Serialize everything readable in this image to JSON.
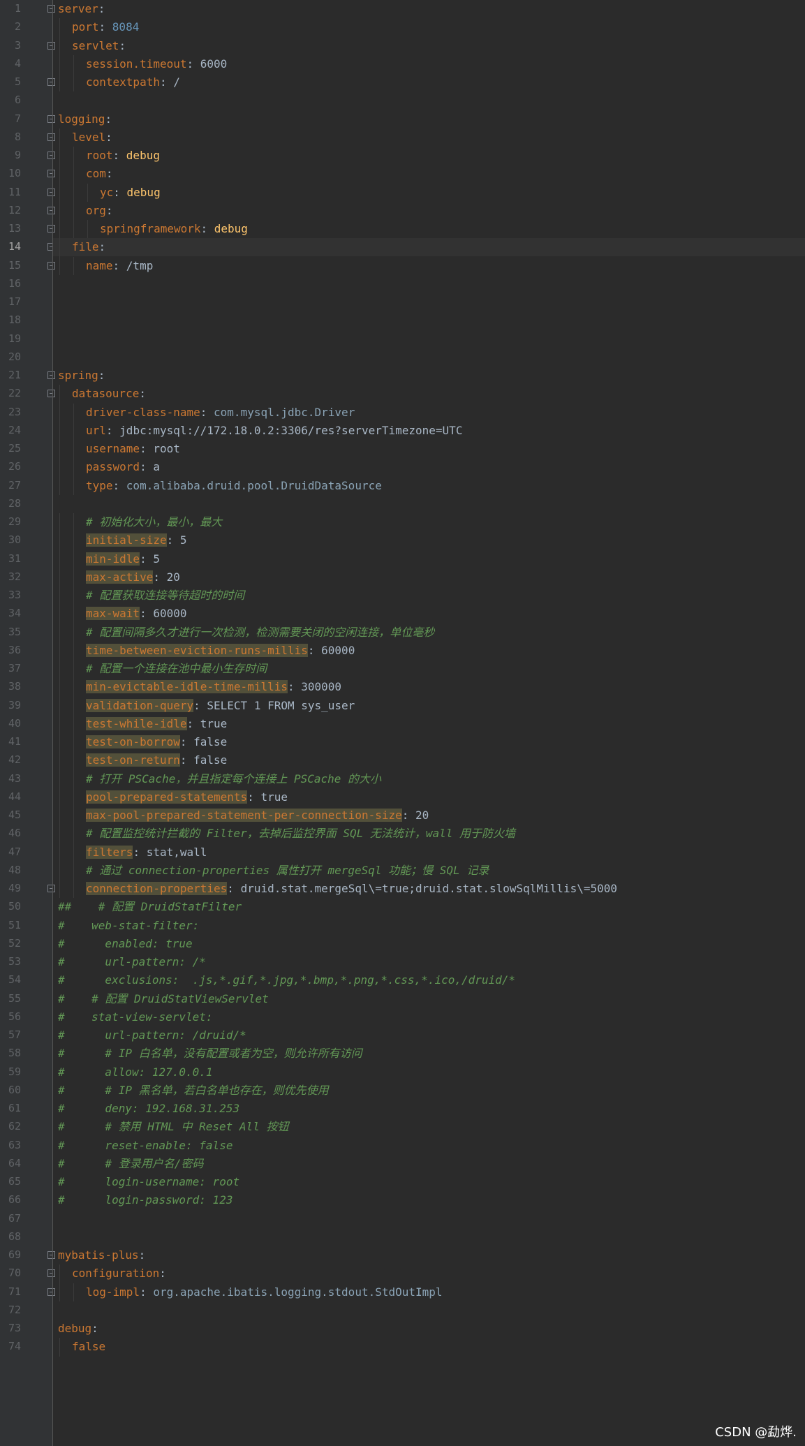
{
  "editor": {
    "current_line": 14,
    "lines": [
      {
        "n": "1",
        "indent": 0,
        "key": "server",
        "sep": ":",
        "val": "",
        "vtype": "",
        "fold": true
      },
      {
        "n": "2",
        "indent": 1,
        "key": "port",
        "sep": ": ",
        "val": "8084",
        "vtype": "vn"
      },
      {
        "n": "3",
        "indent": 1,
        "key": "servlet",
        "sep": ":",
        "val": "",
        "vtype": "",
        "fold": true
      },
      {
        "n": "4",
        "indent": 2,
        "key": "session.timeout",
        "sep": ": ",
        "val": "6000",
        "vtype": "v"
      },
      {
        "n": "5",
        "indent": 2,
        "key": "contextpath",
        "sep": ": ",
        "val": "/",
        "vtype": "v",
        "fold": true
      },
      {
        "n": "6",
        "indent": 0,
        "key": "",
        "sep": "",
        "val": "",
        "vtype": ""
      },
      {
        "n": "7",
        "indent": 0,
        "key": "logging",
        "sep": ":",
        "val": "",
        "vtype": "",
        "fold": true
      },
      {
        "n": "8",
        "indent": 1,
        "key": "level",
        "sep": ":",
        "val": "",
        "vtype": "",
        "fold": true
      },
      {
        "n": "9",
        "indent": 2,
        "key": "root",
        "sep": ": ",
        "val": "debug",
        "vtype": "vk",
        "fold": true
      },
      {
        "n": "10",
        "indent": 2,
        "key": "com",
        "sep": ":",
        "val": "",
        "vtype": "",
        "fold": true
      },
      {
        "n": "11",
        "indent": 3,
        "key": "yc",
        "sep": ": ",
        "val": "debug",
        "vtype": "vk",
        "fold": true
      },
      {
        "n": "12",
        "indent": 2,
        "key": "org",
        "sep": ":",
        "val": "",
        "vtype": "",
        "fold": true
      },
      {
        "n": "13",
        "indent": 3,
        "key": "springframework",
        "sep": ": ",
        "val": "debug",
        "vtype": "vk",
        "fold": true
      },
      {
        "n": "14",
        "indent": 1,
        "key": "file",
        "sep": ":",
        "val": "",
        "vtype": "",
        "fold": true
      },
      {
        "n": "15",
        "indent": 2,
        "key": "name",
        "sep": ": ",
        "val": "/tmp",
        "vtype": "v",
        "fold": true
      },
      {
        "n": "16",
        "indent": 0,
        "key": "",
        "sep": "",
        "val": "",
        "vtype": ""
      },
      {
        "n": "17",
        "indent": 0,
        "key": "",
        "sep": "",
        "val": "",
        "vtype": ""
      },
      {
        "n": "18",
        "indent": 0,
        "key": "",
        "sep": "",
        "val": "",
        "vtype": ""
      },
      {
        "n": "19",
        "indent": 0,
        "key": "",
        "sep": "",
        "val": "",
        "vtype": ""
      },
      {
        "n": "20",
        "indent": 0,
        "key": "",
        "sep": "",
        "val": "",
        "vtype": ""
      },
      {
        "n": "21",
        "indent": 0,
        "key": "spring",
        "sep": ":",
        "val": "",
        "vtype": "",
        "fold": true
      },
      {
        "n": "22",
        "indent": 1,
        "key": "datasource",
        "sep": ":",
        "val": "",
        "vtype": "",
        "fold": true
      },
      {
        "n": "23",
        "indent": 2,
        "key": "driver-class-name",
        "sep": ": ",
        "val": "com.mysql.jdbc.Driver",
        "vtype": "pkgcls"
      },
      {
        "n": "24",
        "indent": 2,
        "key": "url",
        "sep": ": ",
        "val": "jdbc:mysql://172.18.0.2:3306/res?serverTimezone=UTC",
        "vtype": "v"
      },
      {
        "n": "25",
        "indent": 2,
        "key": "username",
        "sep": ": ",
        "val": "root",
        "vtype": "v"
      },
      {
        "n": "26",
        "indent": 2,
        "key": "password",
        "sep": ": ",
        "val": "a",
        "vtype": "v"
      },
      {
        "n": "27",
        "indent": 2,
        "key": "type",
        "sep": ": ",
        "val": "com.alibaba.druid.pool.DruidDataSource",
        "vtype": "pkgcls"
      },
      {
        "n": "28",
        "indent": 0,
        "key": "",
        "sep": "",
        "val": "",
        "vtype": ""
      },
      {
        "n": "29",
        "indent": 2,
        "comment": "# 初始化大小，最小，最大"
      },
      {
        "n": "30",
        "indent": 2,
        "key": "initial-size",
        "sep": ": ",
        "val": "5",
        "vtype": "v",
        "hl": true
      },
      {
        "n": "31",
        "indent": 2,
        "key": "min-idle",
        "sep": ": ",
        "val": "5",
        "vtype": "v",
        "hl": true
      },
      {
        "n": "32",
        "indent": 2,
        "key": "max-active",
        "sep": ": ",
        "val": "20",
        "vtype": "v",
        "hl": true
      },
      {
        "n": "33",
        "indent": 2,
        "comment": "# 配置获取连接等待超时的时间"
      },
      {
        "n": "34",
        "indent": 2,
        "key": "max-wait",
        "sep": ": ",
        "val": "60000",
        "vtype": "v",
        "hl": true
      },
      {
        "n": "35",
        "indent": 2,
        "comment": "# 配置间隔多久才进行一次检测，检测需要关闭的空闲连接，单位毫秒"
      },
      {
        "n": "36",
        "indent": 2,
        "key": "time-between-eviction-runs-millis",
        "sep": ": ",
        "val": "60000",
        "vtype": "v",
        "hl": true
      },
      {
        "n": "37",
        "indent": 2,
        "comment": "# 配置一个连接在池中最小生存时间"
      },
      {
        "n": "38",
        "indent": 2,
        "key": "min-evictable-idle-time-millis",
        "sep": ": ",
        "val": "300000",
        "vtype": "v",
        "hl": true
      },
      {
        "n": "39",
        "indent": 2,
        "key": "validation-query",
        "sep": ": ",
        "val": "SELECT 1 FROM sys_user",
        "vtype": "v",
        "hl": true
      },
      {
        "n": "40",
        "indent": 2,
        "key": "test-while-idle",
        "sep": ": ",
        "val": "true",
        "vtype": "v",
        "hl": true
      },
      {
        "n": "41",
        "indent": 2,
        "key": "test-on-borrow",
        "sep": ": ",
        "val": "false",
        "vtype": "v",
        "hl": true
      },
      {
        "n": "42",
        "indent": 2,
        "key": "test-on-return",
        "sep": ": ",
        "val": "false",
        "vtype": "v",
        "hl": true
      },
      {
        "n": "43",
        "indent": 2,
        "comment": "# 打开 PSCache，并且指定每个连接上 PSCache 的大小"
      },
      {
        "n": "44",
        "indent": 2,
        "key": "pool-prepared-statements",
        "sep": ": ",
        "val": "true",
        "vtype": "v",
        "hl": true
      },
      {
        "n": "45",
        "indent": 2,
        "key": "max-pool-prepared-statement-per-connection-size",
        "sep": ": ",
        "val": "20",
        "vtype": "v",
        "hl": true
      },
      {
        "n": "46",
        "indent": 2,
        "comment": "# 配置监控统计拦截的 Filter，去掉后监控界面 SQL 无法统计，wall 用于防火墙"
      },
      {
        "n": "47",
        "indent": 2,
        "key": "filters",
        "sep": ": ",
        "val": "stat,wall",
        "vtype": "v",
        "hl": true
      },
      {
        "n": "48",
        "indent": 2,
        "comment": "# 通过 connection-properties 属性打开 mergeSql 功能；慢 SQL 记录"
      },
      {
        "n": "49",
        "indent": 2,
        "key": "connection-properties",
        "sep": ": ",
        "val": "druid.stat.mergeSql\\=true;druid.stat.slowSqlMillis\\=5000",
        "vtype": "v",
        "hl": true,
        "fold": true
      },
      {
        "n": "50",
        "indent": 0,
        "comment": "##    # 配置 DruidStatFilter"
      },
      {
        "n": "51",
        "indent": 0,
        "comment": "#    web-stat-filter:"
      },
      {
        "n": "52",
        "indent": 0,
        "comment": "#      enabled: true"
      },
      {
        "n": "53",
        "indent": 0,
        "comment": "#      url-pattern: /*"
      },
      {
        "n": "54",
        "indent": 0,
        "comment": "#      exclusions:  .js,*.gif,*.jpg,*.bmp,*.png,*.css,*.ico,/druid/*"
      },
      {
        "n": "55",
        "indent": 0,
        "comment": "#    # 配置 DruidStatViewServlet"
      },
      {
        "n": "56",
        "indent": 0,
        "comment": "#    stat-view-servlet:"
      },
      {
        "n": "57",
        "indent": 0,
        "comment": "#      url-pattern: /druid/*"
      },
      {
        "n": "58",
        "indent": 0,
        "comment": "#      # IP 白名单，没有配置或者为空，则允许所有访问"
      },
      {
        "n": "59",
        "indent": 0,
        "comment": "#      allow: 127.0.0.1"
      },
      {
        "n": "60",
        "indent": 0,
        "comment": "#      # IP 黑名单，若白名单也存在，则优先使用"
      },
      {
        "n": "61",
        "indent": 0,
        "comment": "#      deny: 192.168.31.253"
      },
      {
        "n": "62",
        "indent": 0,
        "comment": "#      # 禁用 HTML 中 Reset All 按钮"
      },
      {
        "n": "63",
        "indent": 0,
        "comment": "#      reset-enable: false"
      },
      {
        "n": "64",
        "indent": 0,
        "comment": "#      # 登录用户名/密码"
      },
      {
        "n": "65",
        "indent": 0,
        "comment": "#      login-username: root"
      },
      {
        "n": "66",
        "indent": 0,
        "comment": "#      login-password: 123"
      },
      {
        "n": "67",
        "indent": 0,
        "key": "",
        "sep": "",
        "val": "",
        "vtype": ""
      },
      {
        "n": "68",
        "indent": 0,
        "key": "",
        "sep": "",
        "val": "",
        "vtype": ""
      },
      {
        "n": "69",
        "indent": 0,
        "key": "mybatis-plus",
        "sep": ":",
        "val": "",
        "vtype": "",
        "fold": true
      },
      {
        "n": "70",
        "indent": 1,
        "key": "configuration",
        "sep": ":",
        "val": "",
        "vtype": "",
        "fold": true
      },
      {
        "n": "71",
        "indent": 2,
        "key": "log-impl",
        "sep": ": ",
        "val": "org.apache.ibatis.logging.stdout.StdOutImpl",
        "vtype": "pkgcls",
        "fold": true
      },
      {
        "n": "72",
        "indent": 0,
        "key": "",
        "sep": "",
        "val": "",
        "vtype": ""
      },
      {
        "n": "73",
        "indent": 0,
        "key": "debug",
        "sep": ":",
        "val": "",
        "vtype": ""
      },
      {
        "n": "74",
        "indent": 1,
        "key": "false",
        "sep": "",
        "val": "",
        "vtype": ""
      }
    ]
  },
  "watermark": "CSDN @勐烨."
}
